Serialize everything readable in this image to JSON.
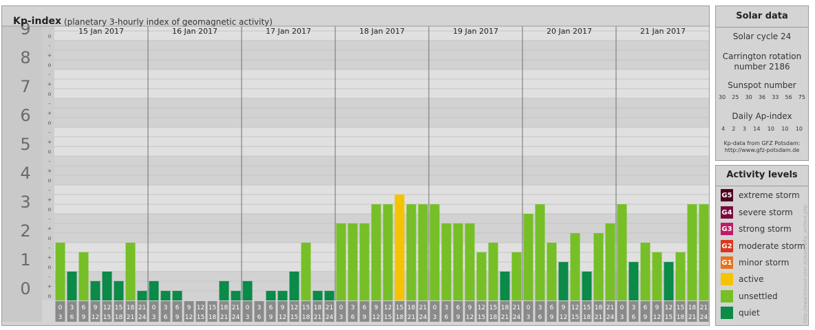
{
  "header": {
    "title": "Kp-index",
    "subtitle": "(planetary 3-hourly index of geomagnetic activity)"
  },
  "chart_data": {
    "type": "bar",
    "title": "Kp-index",
    "subtitle": "(planetary 3-hourly index of geomagnetic activity)",
    "ylim": [
      0,
      9.67
    ],
    "y_ticks": [
      "0",
      "1",
      "2",
      "3",
      "4",
      "5",
      "6",
      "7",
      "8",
      "9"
    ],
    "minor_ticks": [
      "o",
      "+",
      "-"
    ],
    "days": [
      "15 Jan 2017",
      "16 Jan 2017",
      "17 Jan 2017",
      "18 Jan 2017",
      "19 Jan 2017",
      "20 Jan 2017",
      "21 Jan 2017"
    ],
    "slots": [
      [
        "0",
        "3"
      ],
      [
        "3",
        "6"
      ],
      [
        "6",
        "9"
      ],
      [
        "9",
        "12"
      ],
      [
        "12",
        "15"
      ],
      [
        "15",
        "18"
      ],
      [
        "18",
        "21"
      ],
      [
        "21",
        "24"
      ]
    ],
    "series": [
      {
        "values": [
          2,
          1,
          1.67,
          0.67,
          1,
          0.67,
          2,
          0.33
        ]
      },
      {
        "values": [
          0.67,
          0.33,
          0.33,
          0,
          0,
          0,
          0.67,
          0.33
        ]
      },
      {
        "values": [
          0.67,
          0,
          0.33,
          0.33,
          1,
          2,
          0.33,
          0.33
        ]
      },
      {
        "values": [
          2.67,
          2.67,
          2.67,
          3.33,
          3.33,
          3.67,
          3.33,
          3.33
        ]
      },
      {
        "values": [
          3.33,
          2.67,
          2.67,
          2.67,
          1.67,
          2,
          1,
          1.67
        ]
      },
      {
        "values": [
          3,
          3.33,
          2,
          1.33,
          2.33,
          1,
          2.33,
          2.67
        ]
      },
      {
        "values": [
          3.33,
          1.33,
          2,
          1.67,
          1.33,
          1.67,
          3.33,
          3.33
        ]
      }
    ],
    "colors": {
      "quiet": "#0b8a48",
      "unsettled": "#76bf26",
      "active": "#f6c304"
    },
    "grid": true
  },
  "solar": {
    "title": "Solar data",
    "cycle": "Solar cycle 24",
    "carrington_line1": "Carrington rotation",
    "carrington_line2": "number 2186",
    "sunspot_label": "Sunspot number",
    "sunspots": [
      "30",
      "25",
      "30",
      "36",
      "33",
      "56",
      "75"
    ],
    "ap_label": "Daily Ap-index",
    "ap": [
      "4",
      "2",
      "3",
      "14",
      "10",
      "10",
      "10"
    ],
    "source_line1": "Kp-data from GFZ Potsdam:",
    "source_line2": "http://www.gfz-potsdam.de"
  },
  "levels": {
    "title": "Activity levels",
    "items": [
      {
        "badge": "G5",
        "label": "extreme storm",
        "color": "#4d0021"
      },
      {
        "badge": "G4",
        "label": "severe storm",
        "color": "#7a0b3c"
      },
      {
        "badge": "G3",
        "label": "strong storm",
        "color": "#c11a67"
      },
      {
        "badge": "G2",
        "label": "moderate storm",
        "color": "#d9381e"
      },
      {
        "badge": "G1",
        "label": "minor storm",
        "color": "#e8731b"
      },
      {
        "badge": "",
        "label": "active",
        "color": "#f6c304"
      },
      {
        "badge": "",
        "label": "unsettled",
        "color": "#76bf26"
      },
      {
        "badge": "",
        "label": "quiet",
        "color": "#0b8a48"
      }
    ]
  },
  "credit": "http://www.tresure-user.at/aurora/kp_archive.php"
}
